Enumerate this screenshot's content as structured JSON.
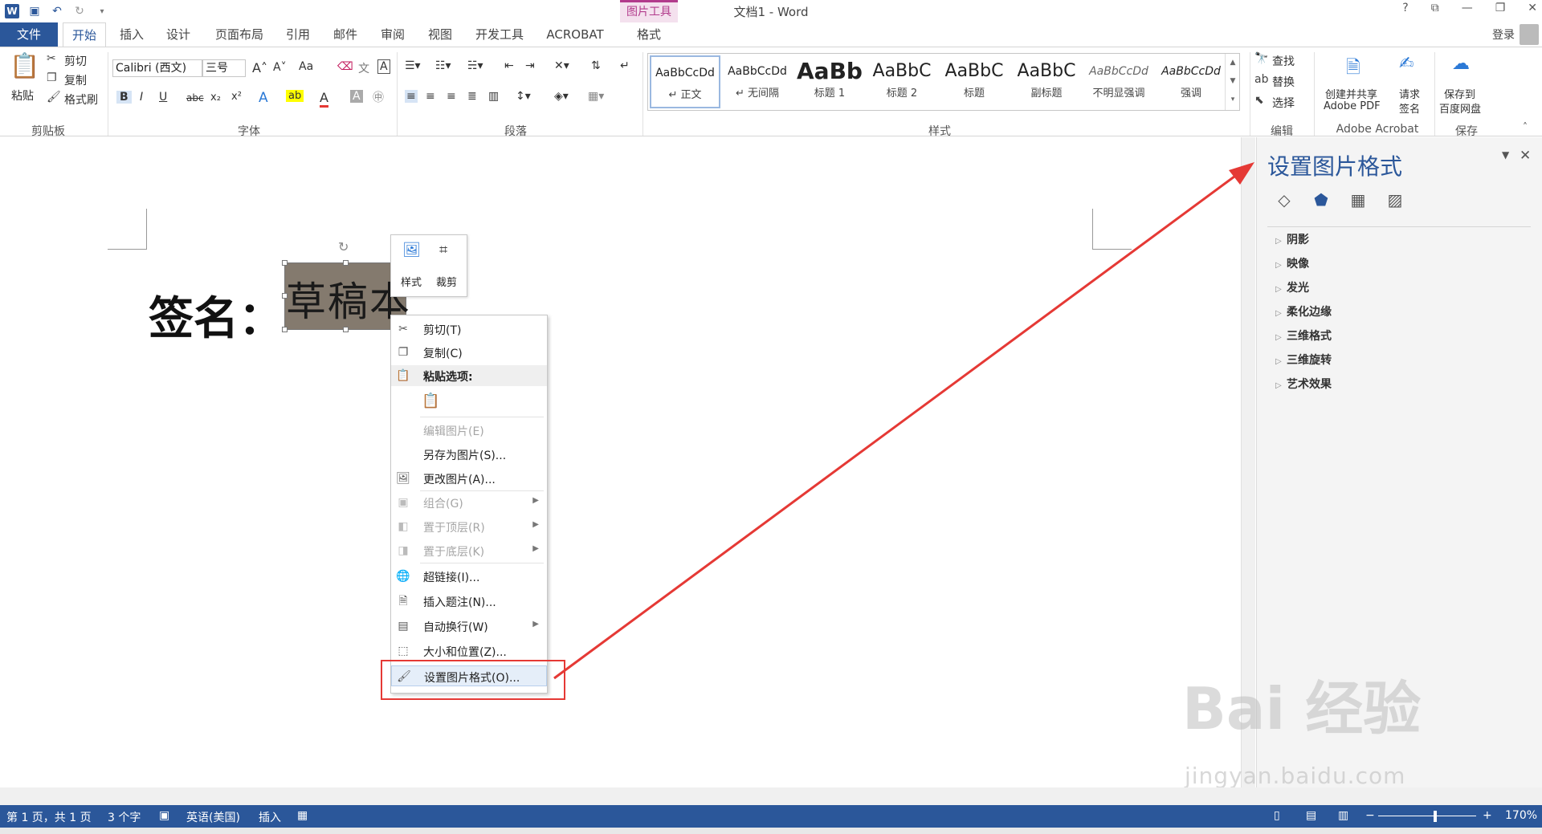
{
  "app": {
    "doc_title": "文档1 - Word",
    "picture_tools": "图片工具",
    "win_buttons": [
      "?",
      "⧉",
      "—",
      "❐",
      "✕"
    ]
  },
  "tabs": {
    "file": "文件",
    "items": [
      "开始",
      "插入",
      "设计",
      "页面布局",
      "引用",
      "邮件",
      "审阅",
      "视图",
      "开发工具",
      "ACROBAT",
      "格式"
    ],
    "active": "开始",
    "login": "登录"
  },
  "ribbon": {
    "clipboard": {
      "paste": "粘贴",
      "cut": "剪切",
      "copy": "复制",
      "format_painter": "格式刷",
      "label": "剪贴板"
    },
    "font": {
      "name": "Calibri (西文)",
      "size": "三号",
      "aa": "Aa",
      "label": "字体"
    },
    "paragraph": {
      "label": "段落"
    },
    "styles": {
      "label": "样式",
      "items": [
        {
          "sample": "AaBbCcDd",
          "name": "↵ 正文"
        },
        {
          "sample": "AaBbCcDd",
          "name": "↵ 无间隔"
        },
        {
          "sample": "AaBb",
          "name": "标题 1"
        },
        {
          "sample": "AaBbC",
          "name": "标题 2"
        },
        {
          "sample": "AaBbC",
          "name": "标题"
        },
        {
          "sample": "AaBbC",
          "name": "副标题"
        },
        {
          "sample": "AaBbCcDd",
          "name": "不明显强调"
        },
        {
          "sample": "AaBbCcDd",
          "name": "强调"
        }
      ]
    },
    "editing": {
      "find": "查找",
      "replace": "替换",
      "select": "选择",
      "label": "编辑"
    },
    "acrobat": {
      "create_share_1": "创建并共享",
      "create_share_2": "Adobe PDF",
      "request_sign_1": "请求",
      "request_sign_2": "签名",
      "label": "Adobe Acrobat"
    },
    "save": {
      "save_to_1": "保存到",
      "save_to_2": "百度网盘",
      "label": "保存"
    }
  },
  "document": {
    "signature_label": "签名：",
    "signature_image_text": "草稿本"
  },
  "mini_toolbar": {
    "style": "样式",
    "crop": "裁剪"
  },
  "context_menu": {
    "cut": "剪切(T)",
    "copy": "复制(C)",
    "paste_options": "粘贴选项:",
    "edit_picture": "编辑图片(E)",
    "save_as_picture": "另存为图片(S)...",
    "change_picture": "更改图片(A)...",
    "group": "组合(G)",
    "bring_to_front": "置于顶层(R)",
    "send_to_back": "置于底层(K)",
    "hyperlink": "超链接(I)...",
    "insert_caption": "插入题注(N)...",
    "wrap_text": "自动换行(W)",
    "size_position": "大小和位置(Z)...",
    "format_picture": "设置图片格式(O)..."
  },
  "format_pane": {
    "title": "设置图片格式",
    "sections": [
      "阴影",
      "映像",
      "发光",
      "柔化边缘",
      "三维格式",
      "三维旋转",
      "艺术效果"
    ]
  },
  "status_bar": {
    "page": "第 1 页，共 1 页",
    "words": "3 个字",
    "language": "英语(美国)",
    "mode": "插入",
    "zoom": "170%"
  },
  "watermark": {
    "brand": "Bai 经验",
    "url": "jingyan.baidu.com"
  },
  "colors": {
    "accent": "#2b579a",
    "picture_tools": "#b23b8c",
    "annotation": "#e53935"
  }
}
